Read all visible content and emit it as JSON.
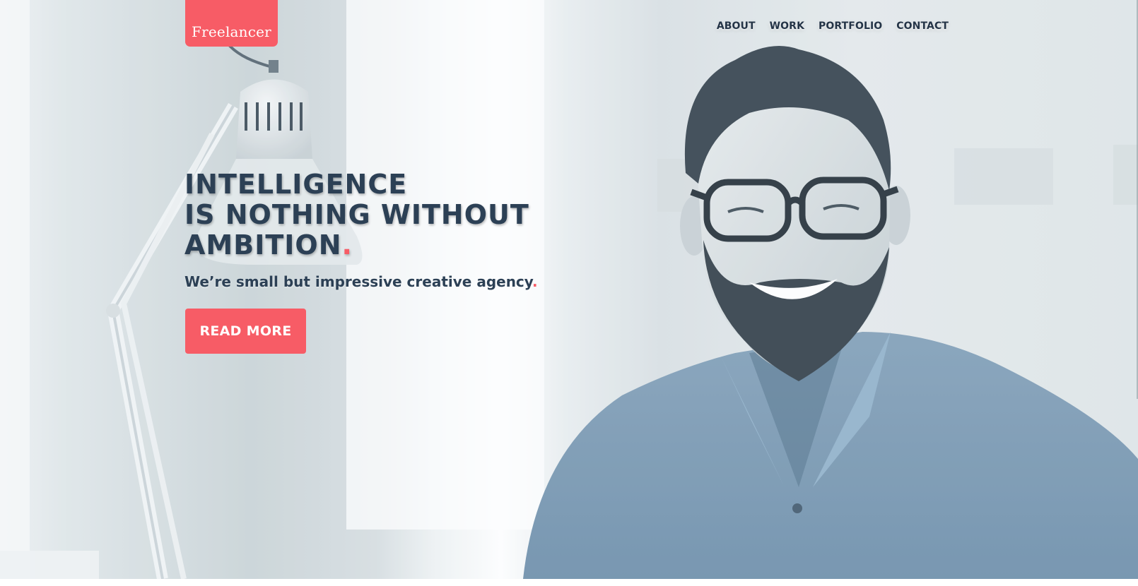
{
  "brand": {
    "logo_text": "Freelancer",
    "accent_color": "#f75c66",
    "text_color": "#2c4055"
  },
  "nav": {
    "items": [
      {
        "label": "ABOUT"
      },
      {
        "label": "WORK"
      },
      {
        "label": "PORTFOLIO"
      },
      {
        "label": "CONTACT"
      }
    ]
  },
  "hero": {
    "headline_lines": [
      "INTELLIGENCE",
      "IS NOTHING WITHOUT",
      "AMBITION"
    ],
    "headline_dot": ".",
    "subheadline": "We’re small but impressive creative agency",
    "subheadline_dot": ".",
    "cta_label": "READ MORE",
    "background_image": "smiling-man-with-glasses-and-desk-lamp"
  }
}
